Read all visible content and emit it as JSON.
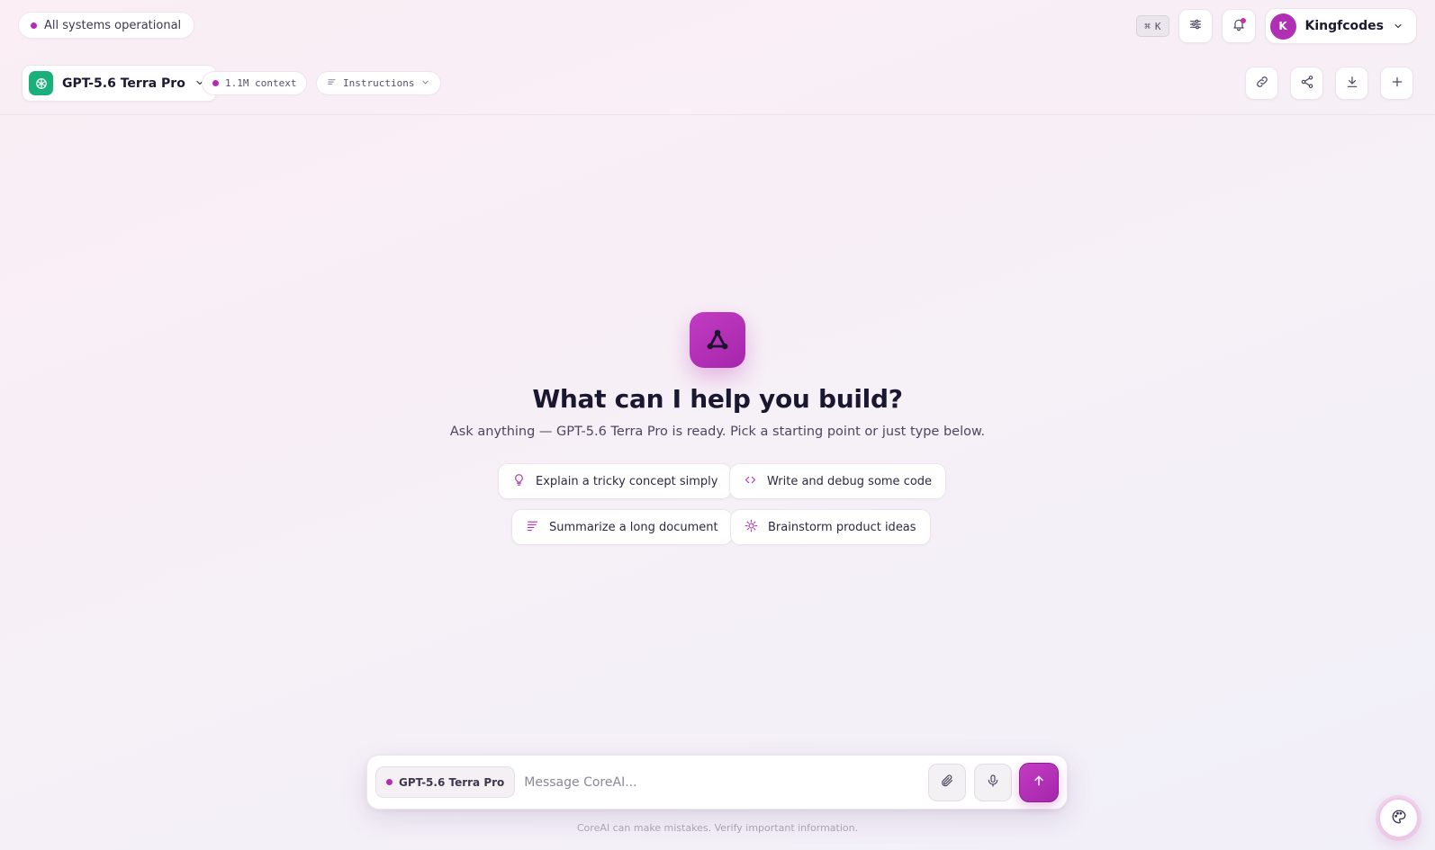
{
  "status": {
    "text": "All systems operational",
    "color": "#b52bb5"
  },
  "header": {
    "shortcut": {
      "symbol": "⌘",
      "key": "K"
    },
    "icons": [
      "sliders-icon",
      "bell-icon"
    ],
    "user": {
      "initial": "K",
      "name": "Kingfcodes"
    }
  },
  "toolbar": {
    "model_name": "GPT-5.6 Terra Pro",
    "context_label": "1.1M context",
    "instructions_label": "Instructions",
    "actions": [
      "link-icon",
      "share-icon",
      "download-icon",
      "plus-icon"
    ]
  },
  "hero": {
    "title": "What can I help you build?",
    "subtitle": "Ask anything — GPT-5.6 Terra Pro is ready. Pick a starting point or just type below."
  },
  "suggestions": [
    {
      "label": "Explain a tricky concept simply",
      "icon": "lightbulb-icon"
    },
    {
      "label": "Write and debug some code",
      "icon": "code-icon"
    },
    {
      "label": "Summarize a long document",
      "icon": "lines-icon"
    },
    {
      "label": "Brainstorm product ideas",
      "icon": "sparkle-bulb-icon"
    }
  ],
  "composer": {
    "model_label": "GPT-5.6 Terra Pro",
    "placeholder": "Message CoreAI...",
    "value": ""
  },
  "footer": {
    "disclaimer": "CoreAI can make mistakes. Verify important information."
  },
  "colors": {
    "accent": "#b12fb4",
    "model_logo": "#19b07c"
  }
}
